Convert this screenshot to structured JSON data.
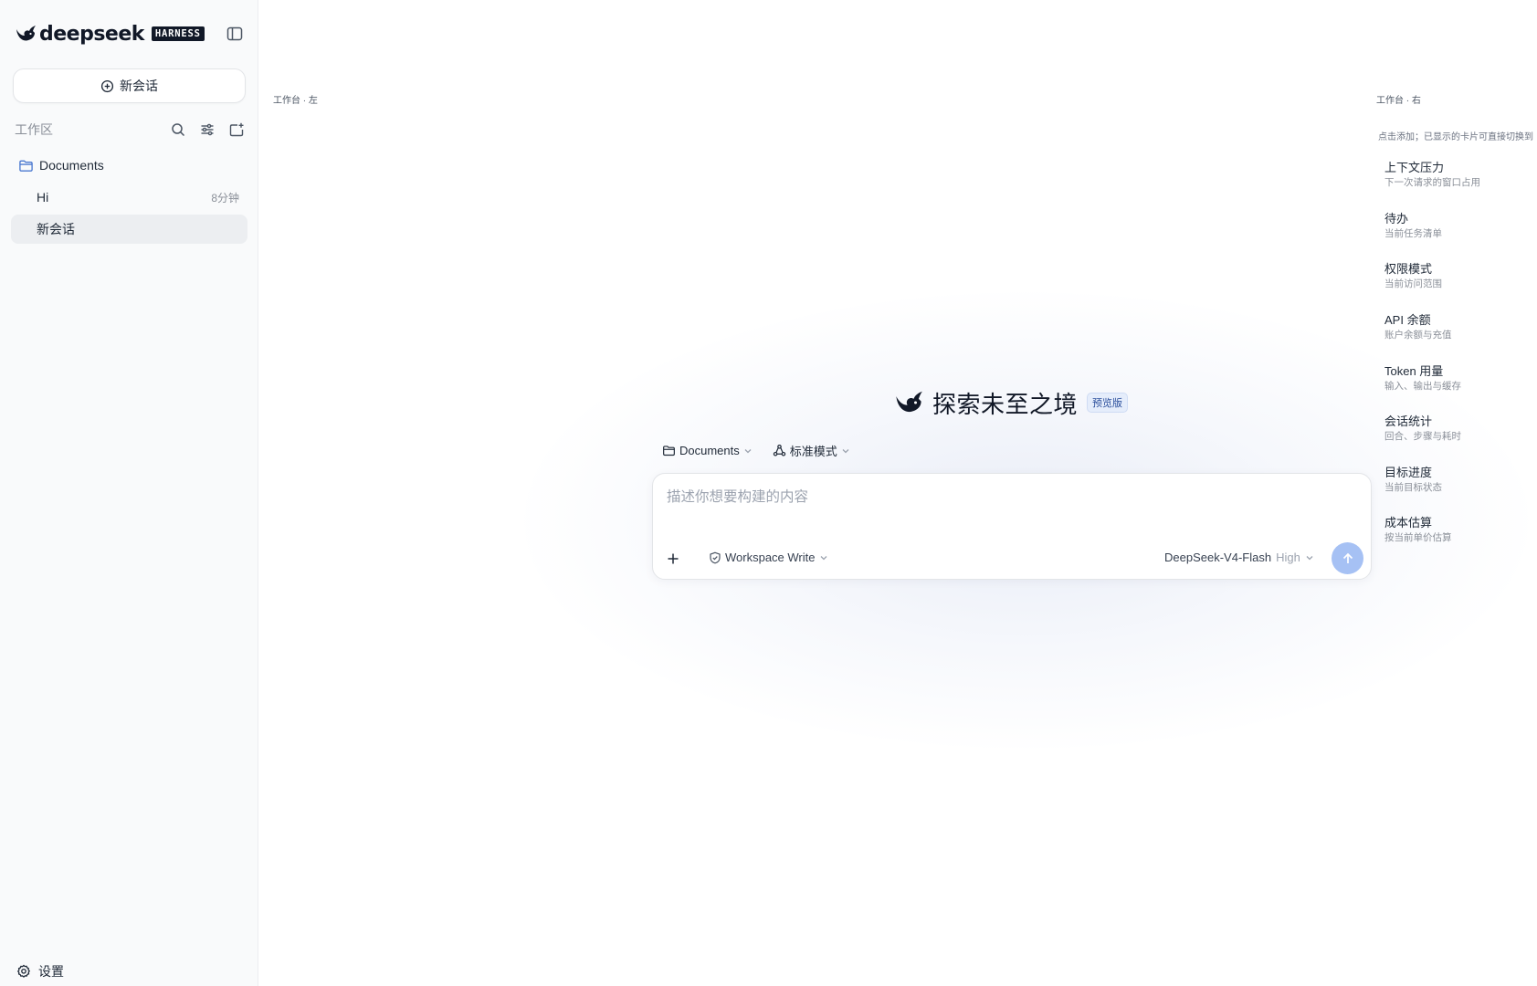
{
  "sidebar": {
    "brand": {
      "name": "deepseek",
      "badge": "HARNESS"
    },
    "new_chat_label": "新会话",
    "workspace_label": "工作区",
    "folder": {
      "name": "Documents"
    },
    "chats": [
      {
        "title": "Hi",
        "time": "8分钟",
        "active": false
      },
      {
        "title": "新会话",
        "time": "",
        "active": true
      }
    ],
    "settings_label": "设置"
  },
  "main": {
    "left_label": "工作台 · 左",
    "hero": {
      "title": "探索未至之境",
      "badge": "预览版"
    },
    "folder_pill": "Documents",
    "mode_pill": "标准模式",
    "composer": {
      "placeholder": "描述你想要构建的内容",
      "value": "",
      "permission": "Workspace Write",
      "model": "DeepSeek-V4-Flash",
      "level": "High"
    }
  },
  "right_panel": {
    "label": "工作台 · 右",
    "hint": "点击添加；已显示的卡片可直接切换到",
    "cards": [
      {
        "title": "上下文压力",
        "subtitle": "下一次请求的窗口占用"
      },
      {
        "title": "待办",
        "subtitle": "当前任务清单"
      },
      {
        "title": "权限模式",
        "subtitle": "当前访问范围"
      },
      {
        "title": "API 余额",
        "subtitle": "账户余额与充值"
      },
      {
        "title": "Token 用量",
        "subtitle": "输入、输出与缓存"
      },
      {
        "title": "会话统计",
        "subtitle": "回合、步骤与耗时"
      },
      {
        "title": "目标进度",
        "subtitle": "当前目标状态"
      },
      {
        "title": "成本估算",
        "subtitle": "按当前单价估算"
      }
    ]
  },
  "colors": {
    "accent": "#a6c1f4",
    "folder_icon": "#4a78d0",
    "badge_bg": "#e5edfb"
  },
  "icons": {
    "brand": "whale-logo-icon",
    "collapse": "sidebar-toggle-icon",
    "new_chat": "plus-circle-icon",
    "search": "search-icon",
    "filter": "sliders-icon",
    "new_folder": "folder-plus-icon",
    "folder": "folder-icon",
    "settings": "gear-icon",
    "send": "arrow-up-icon"
  }
}
